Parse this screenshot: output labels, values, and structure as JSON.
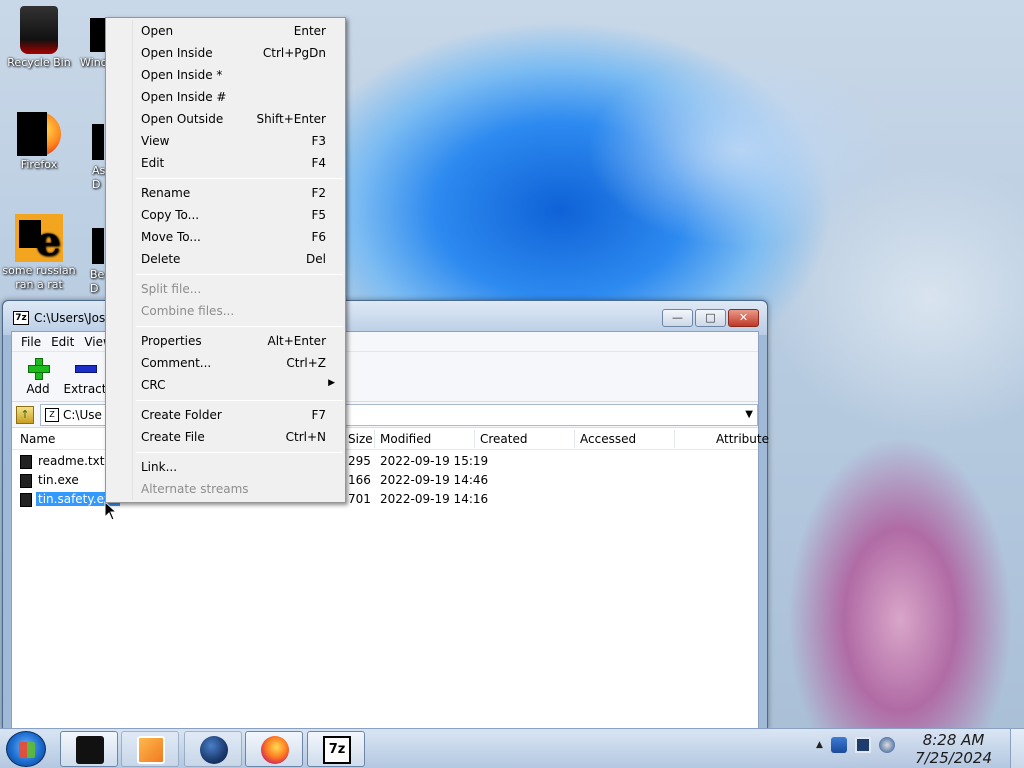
{
  "desktop": {
    "icons": [
      {
        "label": "Recycle Bin",
        "icon": "recycle-bin-icon"
      },
      {
        "label": "Wind",
        "icon": "window-icon"
      },
      {
        "label": "Firefox",
        "icon": "firefox-icon"
      },
      {
        "label": "As\nD",
        "icon": "app-icon"
      },
      {
        "label": "some russian ran a rat",
        "icon": "e-app-icon"
      },
      {
        "label": "Be\nD",
        "icon": "app-icon"
      }
    ]
  },
  "window": {
    "title": "C:\\Users\\Jose",
    "app_icon": "7z",
    "controls": {
      "minimize": "—",
      "maximize": "□",
      "close": "✕"
    },
    "menu": [
      "File",
      "Edit",
      "View"
    ],
    "toolbar": [
      {
        "label": "Add",
        "icon": "add-plus-icon"
      },
      {
        "label": "Extract",
        "icon": "extract-minus-icon"
      },
      {
        "label": "V",
        "icon": ""
      }
    ],
    "address": "C:\\Use",
    "columns": {
      "name": "Name",
      "size": "Size",
      "modified": "Modified",
      "created": "Created",
      "accessed": "Accessed",
      "attributes": "Attribute"
    },
    "files": [
      {
        "name": "readme.txt",
        "size": "295",
        "modified": "2022-09-19 15:19",
        "selected": false
      },
      {
        "name": "tin.exe",
        "size": "166",
        "modified": "2022-09-19 14:46",
        "selected": false
      },
      {
        "name": "tin.safety.exe",
        "size": "701",
        "modified": "2022-09-19 14:16",
        "selected": true
      }
    ]
  },
  "context_menu": {
    "items": [
      {
        "label": "Open",
        "shortcut": "Enter",
        "disabled": false
      },
      {
        "label": "Open Inside",
        "shortcut": "Ctrl+PgDn",
        "disabled": false
      },
      {
        "label": "Open Inside *",
        "shortcut": "",
        "disabled": false
      },
      {
        "label": "Open Inside #",
        "shortcut": "",
        "disabled": false
      },
      {
        "label": "Open Outside",
        "shortcut": "Shift+Enter",
        "disabled": false
      },
      {
        "label": "View",
        "shortcut": "F3",
        "disabled": false
      },
      {
        "label": "Edit",
        "shortcut": "F4",
        "disabled": false
      },
      {
        "label": "Rename",
        "shortcut": "F2",
        "disabled": false
      },
      {
        "label": "Copy To...",
        "shortcut": "F5",
        "disabled": false
      },
      {
        "label": "Move To...",
        "shortcut": "F6",
        "disabled": false
      },
      {
        "label": "Delete",
        "shortcut": "Del",
        "disabled": false
      },
      {
        "label": "Split file...",
        "shortcut": "",
        "disabled": true
      },
      {
        "label": "Combine files...",
        "shortcut": "",
        "disabled": true
      },
      {
        "label": "Properties",
        "shortcut": "Alt+Enter",
        "disabled": false
      },
      {
        "label": "Comment...",
        "shortcut": "Ctrl+Z",
        "disabled": false
      },
      {
        "label": "CRC",
        "shortcut": "",
        "disabled": false,
        "submenu": true
      },
      {
        "label": "Create Folder",
        "shortcut": "F7",
        "disabled": false
      },
      {
        "label": "Create File",
        "shortcut": "Ctrl+N",
        "disabled": false
      },
      {
        "label": "Link...",
        "shortcut": "",
        "disabled": false
      },
      {
        "label": "Alternate streams",
        "shortcut": "",
        "disabled": true
      }
    ],
    "submenu_arrow": "▶"
  },
  "taskbar": {
    "buttons": [
      "black-app-icon",
      "media-player-icon",
      "globe-app-icon",
      "firefox-icon",
      "7zip-icon"
    ],
    "seven_zip_label": "7z",
    "tray_arrow": "▲",
    "time": "8:28 AM",
    "date": "7/25/2024"
  }
}
